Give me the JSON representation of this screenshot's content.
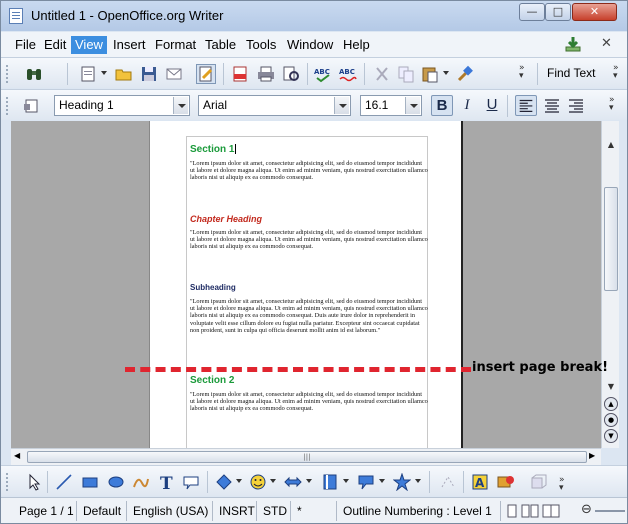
{
  "window": {
    "title": "Untitled 1 - OpenOffice.org Writer",
    "controls": {
      "minimize": "—",
      "maximize": "□",
      "close": "✕"
    }
  },
  "menu": {
    "items": [
      "File",
      "Edit",
      "View",
      "Insert",
      "Format",
      "Table",
      "Tools",
      "Window",
      "Help"
    ],
    "active": "View",
    "close_doc": "✕"
  },
  "standard_toolbar": {
    "icons": [
      "binoculars-icon",
      "new-document-icon",
      "open-folder-icon",
      "save-icon",
      "email-icon",
      "edit-file-icon",
      "export-pdf-icon",
      "print-icon",
      "page-preview-icon",
      "spellcheck-icon",
      "autospellcheck-icon",
      "cut-icon",
      "copy-icon",
      "paste-icon",
      "format-paintbrush-icon"
    ],
    "find_text": "Find Text"
  },
  "formatting_toolbar": {
    "paragraph_style": "Heading 1",
    "font_name": "Arial",
    "font_size": "16.1",
    "bold": "B",
    "italic": "I",
    "underline": "U"
  },
  "document": {
    "blocks": [
      {
        "type": "section",
        "text": "Section 1"
      },
      {
        "type": "para",
        "text": "\"Lorem ipsum dolor sit amet, consectetur adipisicing elit, sed do eiusmod tempor incididunt ut labore et dolore magna aliqua. Ut enim ad minim veniam, quis nostrud exercitation ullamco laboris nisi ut aliquip ex ea commodo consequat."
      },
      {
        "type": "chapter",
        "text": "Chapter Heading"
      },
      {
        "type": "para",
        "text": "\"Lorem ipsum dolor sit amet, consectetur adipisicing elit, sed do eiusmod tempor incididunt ut labore et dolore magna aliqua. Ut enim ad minim veniam, quis nostrud exercitation ullamco laboris nisi ut aliquip ex ea commodo consequat."
      },
      {
        "type": "sub",
        "text": "Subheading"
      },
      {
        "type": "para",
        "text": "\"Lorem ipsum dolor sit amet, consectetur adipisicing elit, sed do eiusmod tempor incididunt ut labore et dolore magna aliqua. Ut enim ad minim veniam, quis nostrud exercitation ullamco laboris nisi ut aliquip ex ea commodo consequat. Duis aute irure dolor in reprehenderit in voluptate velit esse cillum dolore eu fugiat nulla pariatur. Excepteur sint occaecat cupidatat non proident, sunt in culpa qui officia deserunt mollit anim id est laborum.\""
      },
      {
        "type": "section",
        "text": "Section 2"
      },
      {
        "type": "para",
        "text": "\"Lorem ipsum dolor sit amet, consectetur adipisicing elit, sed do eiusmod tempor incididunt ut labore et dolore magna aliqua. Ut enim ad minim veniam, quis nostrud exercitation ullamco laboris nisi ut aliquip ex ea commodo consequat."
      }
    ]
  },
  "annotation": {
    "label": "insert page break!",
    "color": "#e0252f"
  },
  "status_bar": {
    "page": "Page 1 / 1",
    "style": "Default",
    "language": "English (USA)",
    "insert_mode": "INSRT",
    "selection_mode": "STD",
    "modified": "*",
    "outline": "Outline Numbering : Level 1"
  }
}
